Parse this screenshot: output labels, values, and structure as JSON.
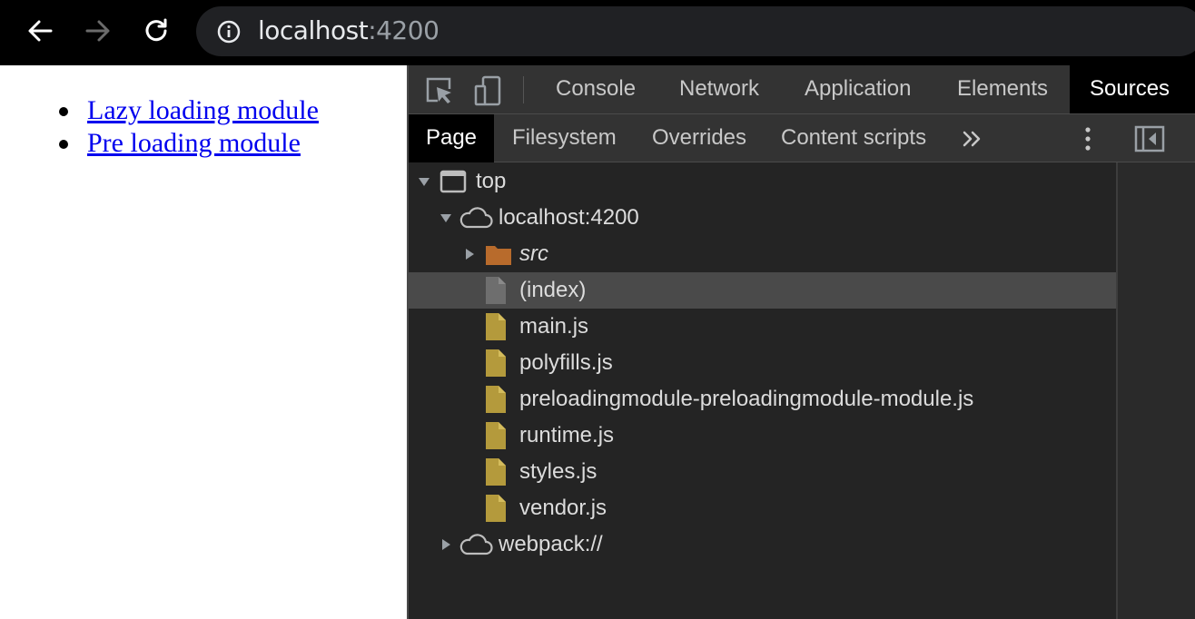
{
  "browser": {
    "address_host": "localhost",
    "address_port": ":4200",
    "icons": {
      "back": "arrow-left-icon",
      "forward": "arrow-right-icon",
      "reload": "reload-icon",
      "info": "info-icon"
    }
  },
  "page": {
    "links": [
      {
        "label": "Lazy loading module"
      },
      {
        "label": "Pre loading module"
      }
    ]
  },
  "devtools": {
    "tabs": [
      {
        "label": "Console"
      },
      {
        "label": "Network"
      },
      {
        "label": "Application"
      },
      {
        "label": "Elements"
      },
      {
        "label": "Sources",
        "active": true
      }
    ],
    "sources": {
      "subtabs": [
        {
          "label": "Page",
          "active": true
        },
        {
          "label": "Filesystem"
        },
        {
          "label": "Overrides"
        },
        {
          "label": "Content scripts"
        }
      ],
      "tree": {
        "top": "top",
        "origin": "localhost:4200",
        "folder": "src",
        "files": [
          {
            "label": "(index)",
            "selected": true,
            "kind": "document"
          },
          {
            "label": "main.js",
            "kind": "script"
          },
          {
            "label": "polyfills.js",
            "kind": "script"
          },
          {
            "label": "preloadingmodule-preloadingmodule-module.js",
            "kind": "script"
          },
          {
            "label": "runtime.js",
            "kind": "script"
          },
          {
            "label": "styles.js",
            "kind": "script"
          },
          {
            "label": "vendor.js",
            "kind": "script"
          }
        ],
        "webpack": "webpack://"
      }
    }
  },
  "colors": {
    "link": "#0000ee",
    "folder": "#b86b2c",
    "script_file": "#b49a3c",
    "document_file": "#6e6e6e",
    "selected_row": "#4a4a4a"
  }
}
